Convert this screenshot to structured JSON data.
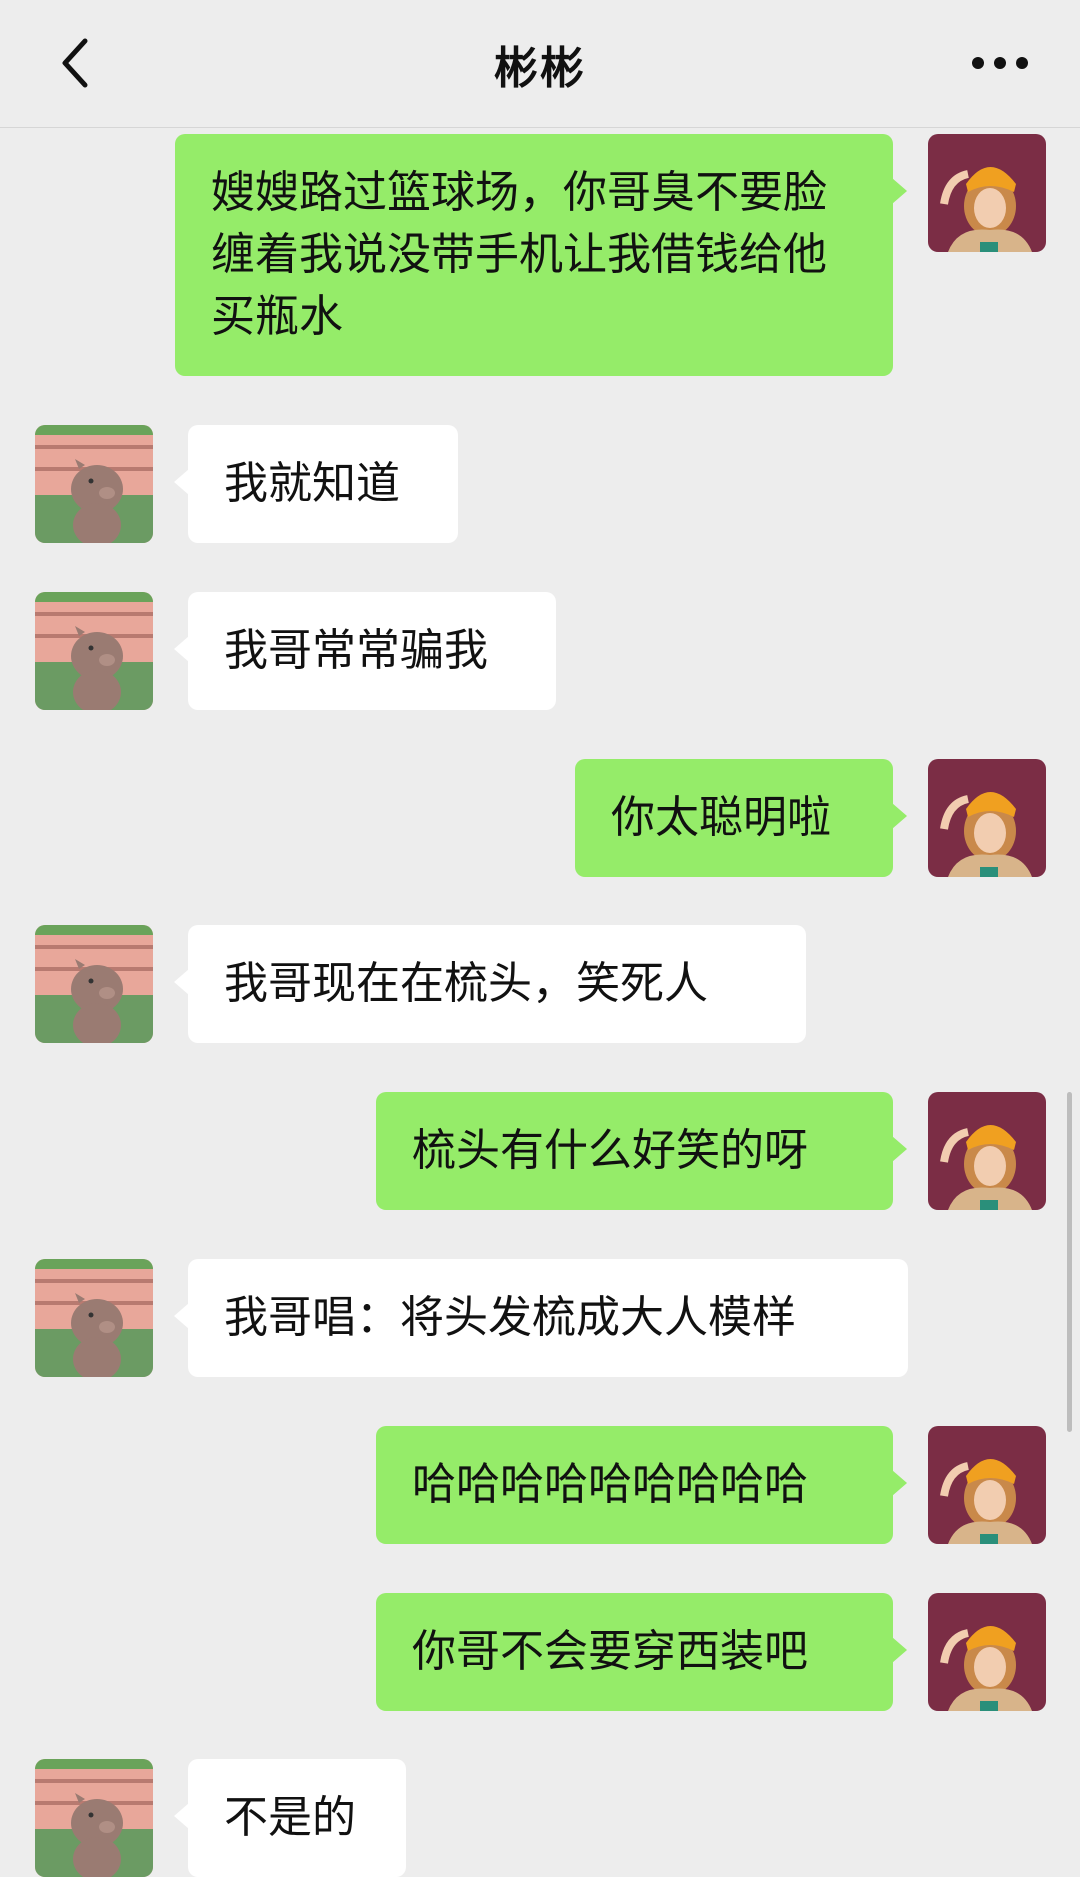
{
  "header": {
    "title": "彬彬",
    "back_icon": "chevron-left-icon",
    "more_icon": "more-dots-icon"
  },
  "colors": {
    "background": "#ededed",
    "my_bubble": "#95ec69",
    "other_bubble": "#ffffff"
  },
  "messages": [
    {
      "from": "me",
      "text": "嫂嫂路过篮球场，你哥臭不要脸缠着我说没带手机让我借钱给他买瓶水"
    },
    {
      "from": "other",
      "text": "我就知道"
    },
    {
      "from": "other",
      "text": "我哥常常骗我"
    },
    {
      "from": "me",
      "text": "你太聪明啦"
    },
    {
      "from": "other",
      "text": "我哥现在在梳头，笑死人"
    },
    {
      "from": "me",
      "text": "梳头有什么好笑的呀"
    },
    {
      "from": "other",
      "text": "我哥唱：将头发梳成大人模样"
    },
    {
      "from": "me",
      "text": "哈哈哈哈哈哈哈哈哈"
    },
    {
      "from": "me",
      "text": "你哥不会要穿西装吧"
    },
    {
      "from": "other",
      "text": "不是的"
    }
  ]
}
